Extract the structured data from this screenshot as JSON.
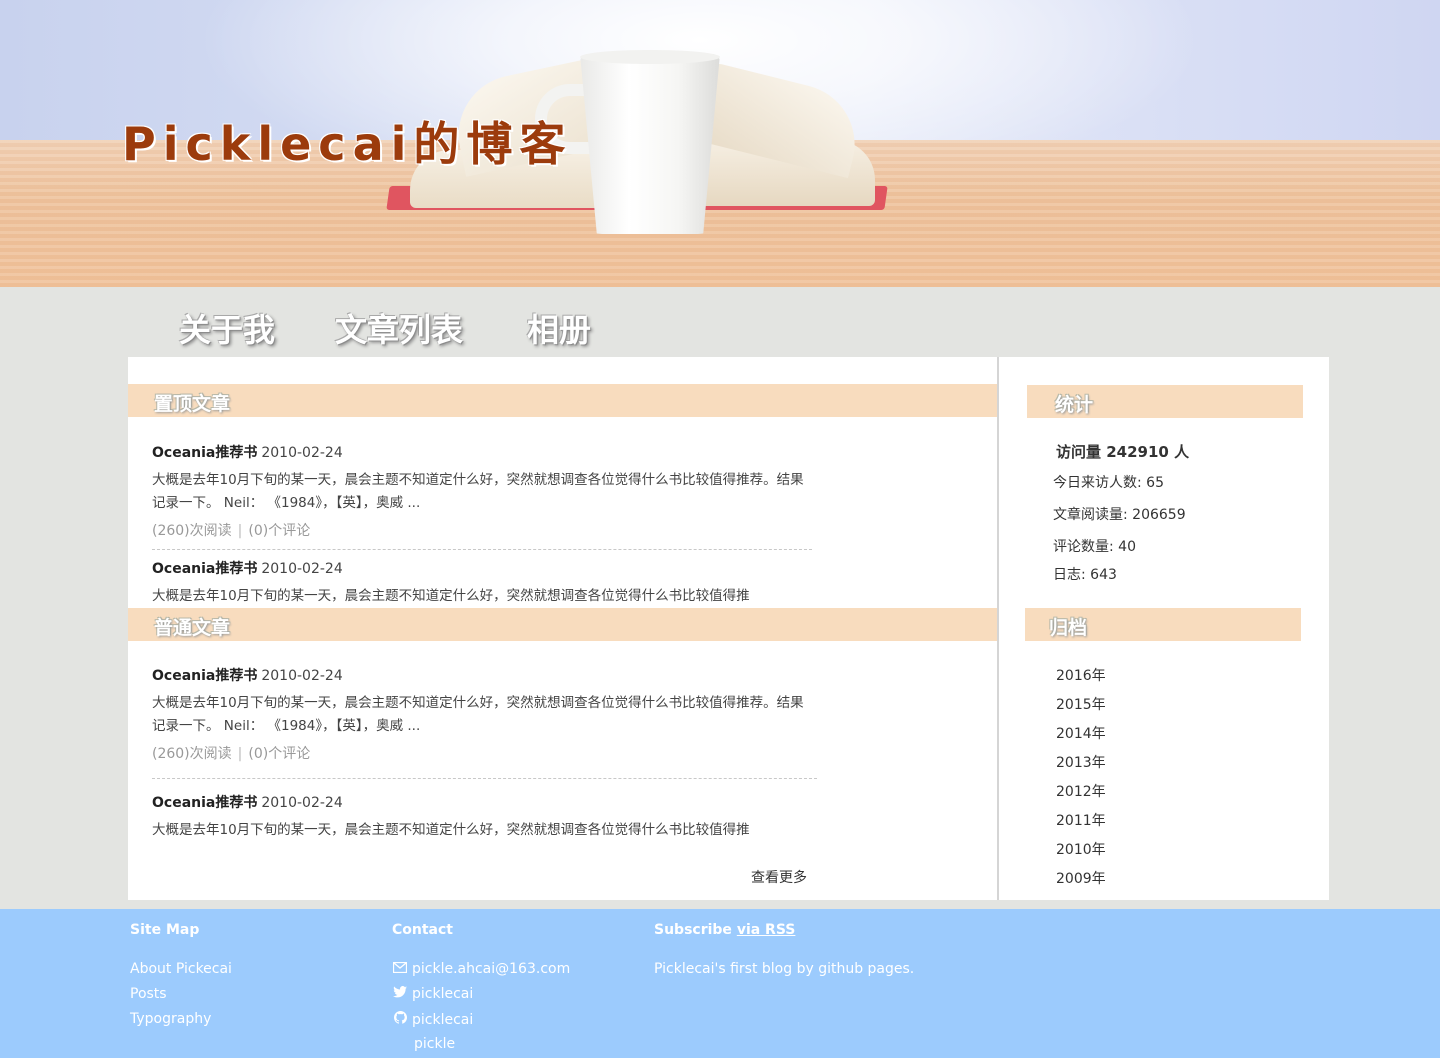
{
  "header": {
    "title": "Picklecai的博客"
  },
  "nav": {
    "items": [
      {
        "label": "关于我"
      },
      {
        "label": "文章列表"
      },
      {
        "label": "相册"
      }
    ]
  },
  "main": {
    "pinned": {
      "title": "置顶文章",
      "posts": [
        {
          "title": "Oceania推荐书",
          "date": "2010-02-24",
          "excerpt": "大概是去年10月下旬的某一天，晨会主题不知道定什么好，突然就想调查各位觉得什么书比较值得推荐。结果记录一下。 Neil： 《1984》，【英】，奥威 ...",
          "reads": "(260)次阅读",
          "sep": "|",
          "comments": "(0)个评论"
        },
        {
          "title": "Oceania推荐书",
          "date": "2010-02-24",
          "excerpt": "大概是去年10月下旬的某一天，晨会主题不知道定什么好，突然就想调查各位觉得什么书比较值得推"
        }
      ]
    },
    "normal": {
      "title": "普通文章",
      "posts": [
        {
          "title": "Oceania推荐书",
          "date": "2010-02-24",
          "excerpt": "大概是去年10月下旬的某一天，晨会主题不知道定什么好，突然就想调查各位觉得什么书比较值得推荐。结果记录一下。 Neil： 《1984》，【英】，奥威 ...",
          "reads": "(260)次阅读",
          "sep": "|",
          "comments": "(0)个评论"
        },
        {
          "title": "Oceania推荐书",
          "date": "2010-02-24",
          "excerpt": "大概是去年10月下旬的某一天，晨会主题不知道定什么好，突然就想调查各位觉得什么书比较值得推"
        }
      ]
    },
    "more_label": "查看更多"
  },
  "sidebar": {
    "stats": {
      "title": "统计",
      "total_visits": "访问量 242910 人",
      "today_visitors": "今日来访人数: 65",
      "article_reads": "文章阅读量: 206659",
      "comment_count": "评论数量: 40",
      "log_count": "日志: 643"
    },
    "archive": {
      "title": "归档",
      "years": [
        "2016年",
        "2015年",
        "2014年",
        "2013年",
        "2012年",
        "2011年",
        "2010年",
        "2009年"
      ]
    }
  },
  "footer": {
    "sitemap": {
      "title": "Site Map",
      "links": [
        "About Pickecai",
        "Posts",
        "Typography"
      ]
    },
    "contact": {
      "title": "Contact",
      "email": "pickle.ahcai@163.com",
      "twitter": "picklecai",
      "github": "picklecai",
      "other": "pickle"
    },
    "subscribe": {
      "title": "Subscribe",
      "rss_label": "via RSS",
      "description": "Picklecai's first blog by github pages."
    }
  },
  "colors": {
    "section_bar": "#f8dcbe",
    "footer_bg": "#9ccbfd",
    "title_color": "#9c3b0c",
    "page_bg": "#e3e4e1"
  }
}
